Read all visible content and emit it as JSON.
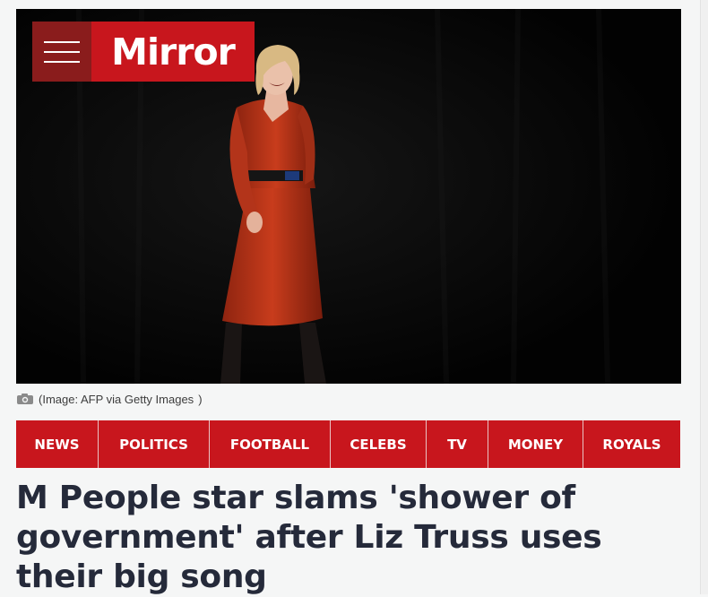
{
  "brand": {
    "name": "Mirror",
    "color": "#c8161d",
    "menu_icon": "hamburger-icon"
  },
  "hero": {
    "alt": "Woman in a red dress laughing on a dark stage",
    "caption": "Image: AFP via Getty Images",
    "caption_icon": "camera-icon"
  },
  "nav": {
    "items": [
      {
        "label": "NEWS"
      },
      {
        "label": "POLITICS"
      },
      {
        "label": "FOOTBALL"
      },
      {
        "label": "CELEBS"
      },
      {
        "label": "TV"
      },
      {
        "label": "MONEY"
      },
      {
        "label": "ROYALS"
      }
    ]
  },
  "article": {
    "headline": "M People star slams 'shower of government' after Liz Truss uses their big song"
  }
}
